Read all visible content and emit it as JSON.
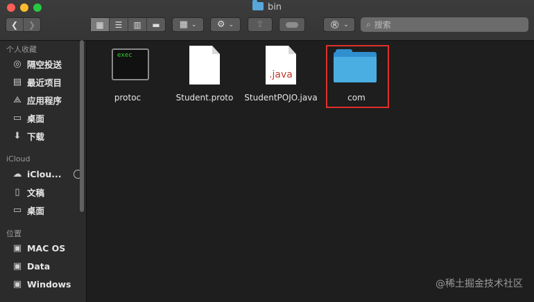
{
  "window": {
    "title": "bin"
  },
  "toolbar": {
    "view_icons": [
      "grid-view-icon",
      "list-view-icon",
      "column-view-icon",
      "gallery-view-icon"
    ],
    "search_placeholder": "搜索",
    "registered_glyph": "®"
  },
  "sidebar": {
    "sections": [
      {
        "title": "个人收藏",
        "items": [
          {
            "label": "隔空投送",
            "icon": "airdrop-icon"
          },
          {
            "label": "最近项目",
            "icon": "recents-icon"
          },
          {
            "label": "应用程序",
            "icon": "applications-icon"
          },
          {
            "label": "桌面",
            "icon": "desktop-icon"
          },
          {
            "label": "下载",
            "icon": "downloads-icon"
          }
        ]
      },
      {
        "title": "iCloud",
        "items": [
          {
            "label": "iClou...",
            "icon": "icloud-icon"
          },
          {
            "label": "文稿",
            "icon": "documents-icon"
          },
          {
            "label": "桌面",
            "icon": "desktop-icon"
          }
        ]
      },
      {
        "title": "位置",
        "items": [
          {
            "label": "MAC OS",
            "icon": "disk-icon"
          },
          {
            "label": "Data",
            "icon": "disk-icon"
          },
          {
            "label": "Windows",
            "icon": "disk-icon"
          }
        ]
      }
    ]
  },
  "files": [
    {
      "name": "protoc",
      "kind": "exec",
      "badge": "exec"
    },
    {
      "name": "Student.proto",
      "kind": "document"
    },
    {
      "name": "StudentPOJO.java",
      "kind": "java",
      "badge": ".java"
    },
    {
      "name": "com",
      "kind": "folder",
      "selected": true
    }
  ],
  "watermark": "@稀土掘金技术社区",
  "colors": {
    "highlight": "#e0302a",
    "folder": "#4aaee3",
    "exec_text": "#2fd52f"
  }
}
